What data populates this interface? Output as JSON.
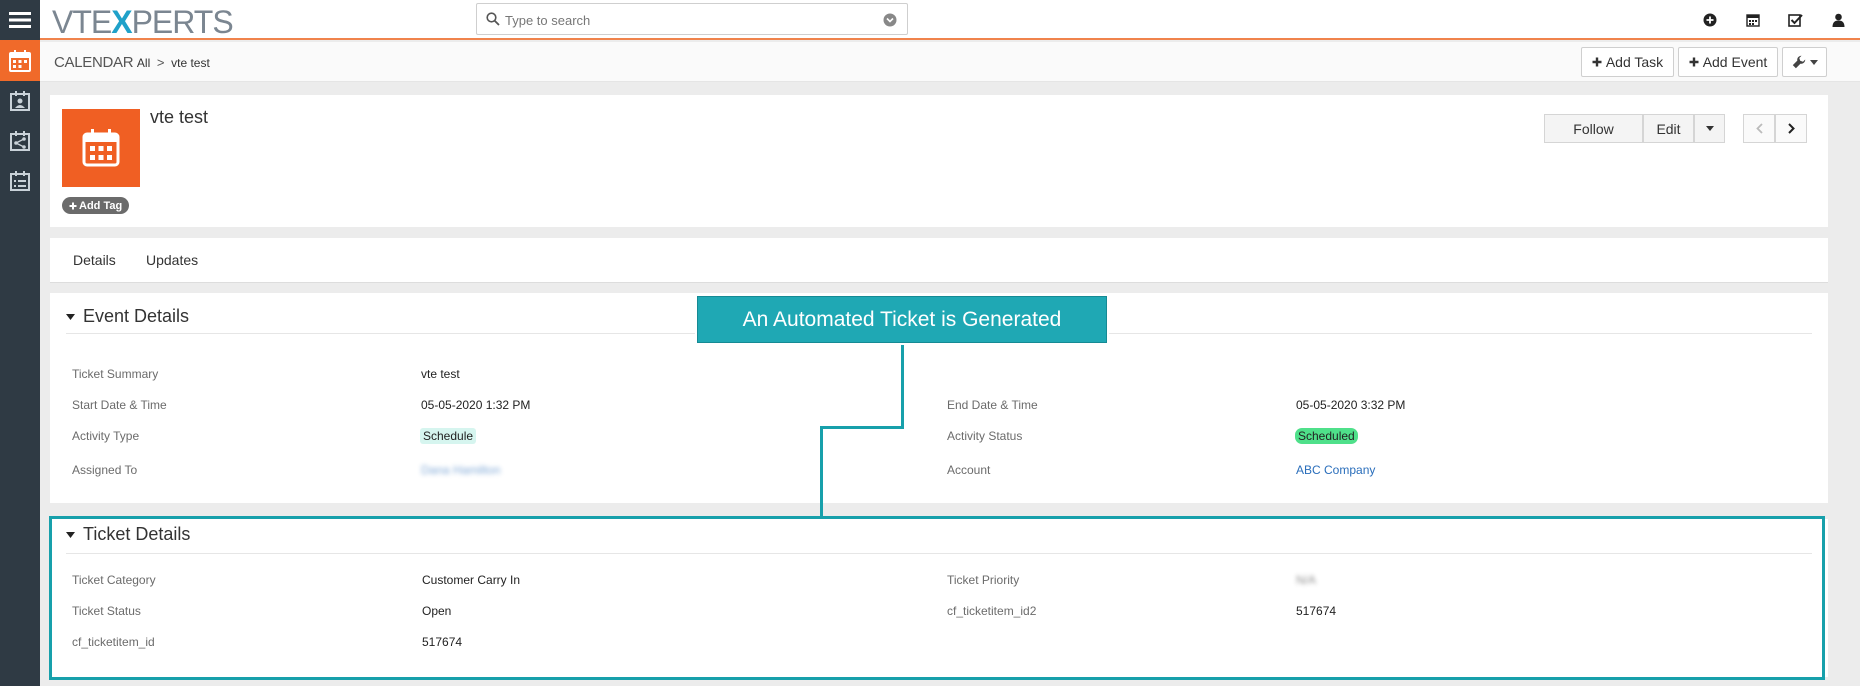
{
  "app": {
    "logo_left": "VTE",
    "logo_x": "X",
    "logo_right": "PERTS"
  },
  "search": {
    "placeholder": "Type to search"
  },
  "breadcrumb": {
    "module": "CALENDAR",
    "filter": "All",
    "record": "vte test"
  },
  "header_buttons": {
    "add_task": "Add Task",
    "add_event": "Add Event"
  },
  "record": {
    "title": "vte test",
    "add_tag": "Add Tag",
    "follow": "Follow",
    "edit": "Edit"
  },
  "tabs": [
    {
      "label": "Details"
    },
    {
      "label": "Updates"
    }
  ],
  "event_details": {
    "title": "Event Details",
    "fields": {
      "ticket_summary": {
        "label": "Ticket Summary",
        "value": "vte test"
      },
      "start": {
        "label": "Start Date & Time",
        "value": "05-05-2020 1:32 PM"
      },
      "end": {
        "label": "End Date & Time",
        "value": "05-05-2020 3:32 PM"
      },
      "activity_type": {
        "label": "Activity Type",
        "value": "Schedule"
      },
      "activity_status": {
        "label": "Activity Status",
        "value": "Scheduled"
      },
      "assigned_to": {
        "label": "Assigned To",
        "value": "Dana Hamilton"
      },
      "account": {
        "label": "Account",
        "value": "ABC Company"
      }
    }
  },
  "ticket_details": {
    "title": "Ticket Details",
    "fields": {
      "category": {
        "label": "Ticket Category",
        "value": "Customer Carry In"
      },
      "priority": {
        "label": "Ticket Priority",
        "value": "N/A"
      },
      "status": {
        "label": "Ticket Status",
        "value": "Open"
      },
      "item_id2": {
        "label": "cf_ticketitem_id2",
        "value": "517674"
      },
      "item_id": {
        "label": "cf_ticketitem_id",
        "value": "517674"
      }
    }
  },
  "annotation": {
    "text": "An Automated Ticket is Generated"
  },
  "colors": {
    "accent": "#f05f23",
    "sidebar": "#2f3a44",
    "annotation": "#1fa8b4",
    "link": "#2a6ebb"
  },
  "icons": [
    "hamburger-icon",
    "calendar-icon",
    "contacts-icon",
    "share-icon",
    "list-icon",
    "search-icon",
    "chevron-down-icon",
    "plus-circle-icon",
    "calendar-icon",
    "checkbox-icon",
    "user-icon",
    "plus-icon",
    "wrench-icon",
    "chevron-left-icon",
    "chevron-right-icon",
    "caret-down-icon"
  ]
}
